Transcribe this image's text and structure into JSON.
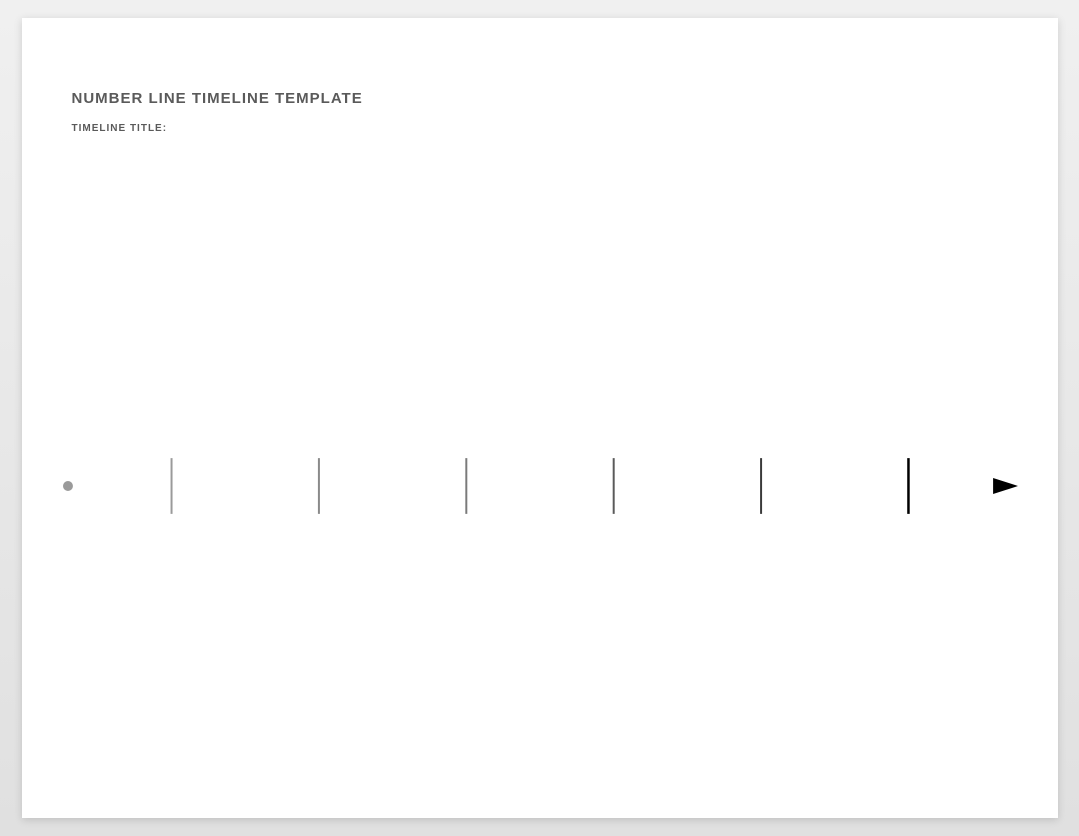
{
  "header": {
    "title": "NUMBER LINE TIMELINE TEMPLATE",
    "subtitle": "TIMELINE TITLE:"
  },
  "timeline": {
    "tick_count": 6,
    "start_dot": true,
    "arrow_end": true
  }
}
